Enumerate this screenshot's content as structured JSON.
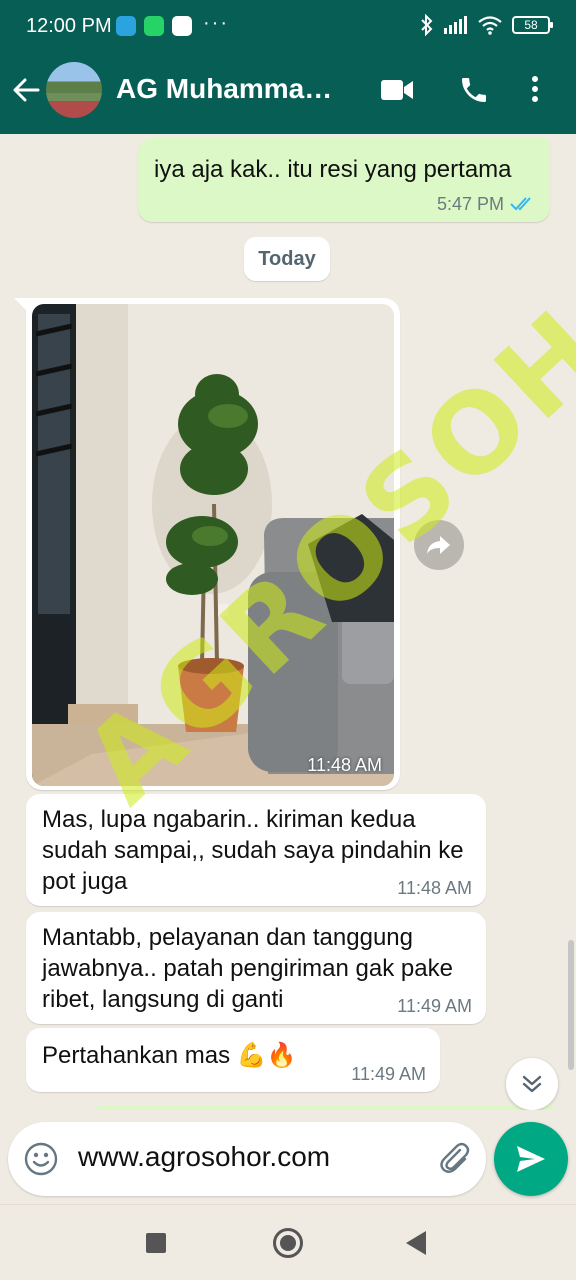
{
  "status_bar": {
    "time": "12:00 PM",
    "dots": "···",
    "battery": "58"
  },
  "header": {
    "contact_name": "AG Muhammad Baihaki"
  },
  "messages": [
    {
      "direction": "out",
      "text": "iya aja kak.. itu resi yang pertama",
      "time": "5:47 PM"
    },
    {
      "direction": "in",
      "type": "image",
      "time": "11:48 AM"
    },
    {
      "direction": "in",
      "text": "Mas, lupa ngabarin.. kiriman kedua sudah sampai,, sudah saya pindahin ke pot juga",
      "time": "11:48 AM"
    },
    {
      "direction": "in",
      "text": "Mantabb, pelayanan dan tanggung jawabnya.. patah pengiriman gak pake ribet, langsung di ganti",
      "time": "11:49 AM"
    },
    {
      "direction": "in",
      "text": "Pertahankan mas 💪🔥",
      "time": "11:49 AM"
    }
  ],
  "date_chip": "Today",
  "watermark": "AGROSOHOR",
  "composer": {
    "text": "www.agrosohor.com"
  },
  "colors": {
    "header": "#075e54",
    "outgoing": "#dcf8c6",
    "send": "#00a884",
    "tick": "#34b7f1"
  }
}
